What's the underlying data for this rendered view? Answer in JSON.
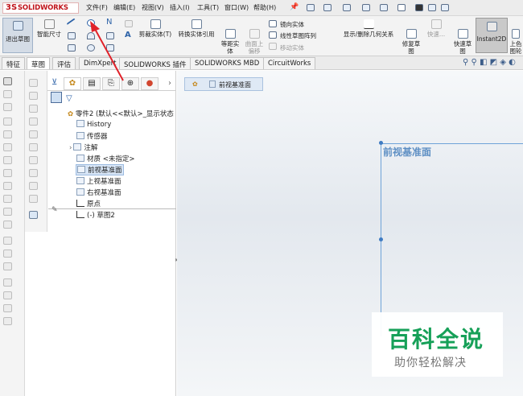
{
  "app": {
    "logo_ds": "3S",
    "logo_text": "SOLIDWORKS"
  },
  "menu": [
    "文件(F)",
    "编辑(E)",
    "视图(V)",
    "插入(I)",
    "工具(T)",
    "窗口(W)",
    "帮助(H)"
  ],
  "ribbon": {
    "exit_sketch": "退出草图",
    "smart_dim": "智能尺寸",
    "trim": "剪裁实体(T)",
    "convert": "转换实体引用",
    "offset": "等距实\n体",
    "surface_offset": "曲面上\n偏移",
    "mirror": "镜向实体",
    "linear_pattern": "线性草图阵列",
    "move": "移动实体",
    "relations": "显示/删除几何关系",
    "repair": "修复草\n图",
    "quick": "快速...",
    "rapid_sketch": "快速草\n图",
    "instant2d": "Instant2D",
    "shaded": "上色\n图轮"
  },
  "tabs": [
    "特征",
    "草图",
    "评估",
    "DimXpert",
    "SOLIDWORKS 插件",
    "SOLIDWORKS MBD",
    "CircuitWorks"
  ],
  "tree": {
    "root": "零件2 (默认<<默认>_显示状态",
    "items": [
      "History",
      "传感器",
      "注解",
      "材质 <未指定>",
      "前视基准面",
      "上视基准面",
      "右视基准面",
      "原点",
      "(-) 草图2"
    ]
  },
  "graphics": {
    "breadcrumb": "前视基准面",
    "plane_label": "前视基准面"
  },
  "watermark": {
    "title": "百科全说",
    "subtitle": "助你轻松解决"
  },
  "colors": {
    "brand_red": "#c0141b",
    "plane_blue": "#5e8fc4",
    "arrow_red": "#e0222a",
    "watermark_green": "#16a058"
  }
}
